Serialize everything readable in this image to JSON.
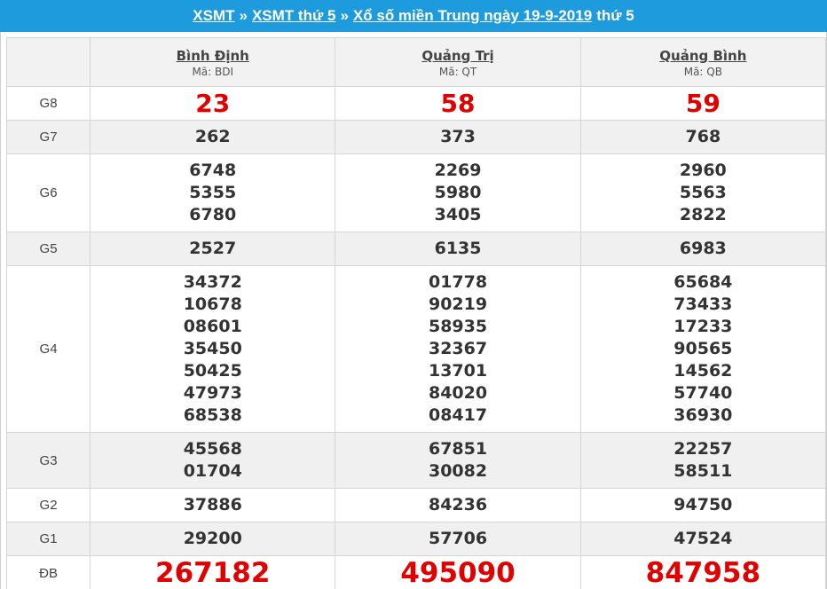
{
  "header": {
    "link1": "XSMT",
    "sep1": "»",
    "link2": "XSMT thứ 5",
    "sep2": "»",
    "link3": "Xổ số miền Trung ngày 19-9-2019",
    "suffix": "thứ 5"
  },
  "provinces": [
    {
      "name": "Bình Định",
      "code": "Mã: BDI"
    },
    {
      "name": "Quảng Trị",
      "code": "Mã: QT"
    },
    {
      "name": "Quảng Bình",
      "code": "Mã: QB"
    }
  ],
  "prizes": [
    {
      "label": "G8",
      "values": [
        [
          "23"
        ],
        [
          "58"
        ],
        [
          "59"
        ]
      ]
    },
    {
      "label": "G7",
      "values": [
        [
          "262"
        ],
        [
          "373"
        ],
        [
          "768"
        ]
      ]
    },
    {
      "label": "G6",
      "values": [
        [
          "6748",
          "5355",
          "6780"
        ],
        [
          "2269",
          "5980",
          "3405"
        ],
        [
          "2960",
          "5563",
          "2822"
        ]
      ]
    },
    {
      "label": "G5",
      "values": [
        [
          "2527"
        ],
        [
          "6135"
        ],
        [
          "6983"
        ]
      ]
    },
    {
      "label": "G4",
      "values": [
        [
          "34372",
          "10678",
          "08601",
          "35450",
          "50425",
          "47973",
          "68538"
        ],
        [
          "01778",
          "90219",
          "58935",
          "32367",
          "13701",
          "84020",
          "08417"
        ],
        [
          "65684",
          "73433",
          "17233",
          "90565",
          "14562",
          "57740",
          "36930"
        ]
      ]
    },
    {
      "label": "G3",
      "values": [
        [
          "45568",
          "01704"
        ],
        [
          "67851",
          "30082"
        ],
        [
          "22257",
          "58511"
        ]
      ]
    },
    {
      "label": "G2",
      "values": [
        [
          "37886"
        ],
        [
          "84236"
        ],
        [
          "94750"
        ]
      ]
    },
    {
      "label": "G1",
      "values": [
        [
          "29200"
        ],
        [
          "57706"
        ],
        [
          "47524"
        ]
      ]
    },
    {
      "label": "ĐB",
      "values": [
        [
          "267182"
        ],
        [
          "495090"
        ],
        [
          "847958"
        ]
      ]
    }
  ],
  "colors": {
    "header_bg": "#1e9bdc",
    "highlight": "#e00000",
    "alt_row": "#f0f0f0"
  }
}
